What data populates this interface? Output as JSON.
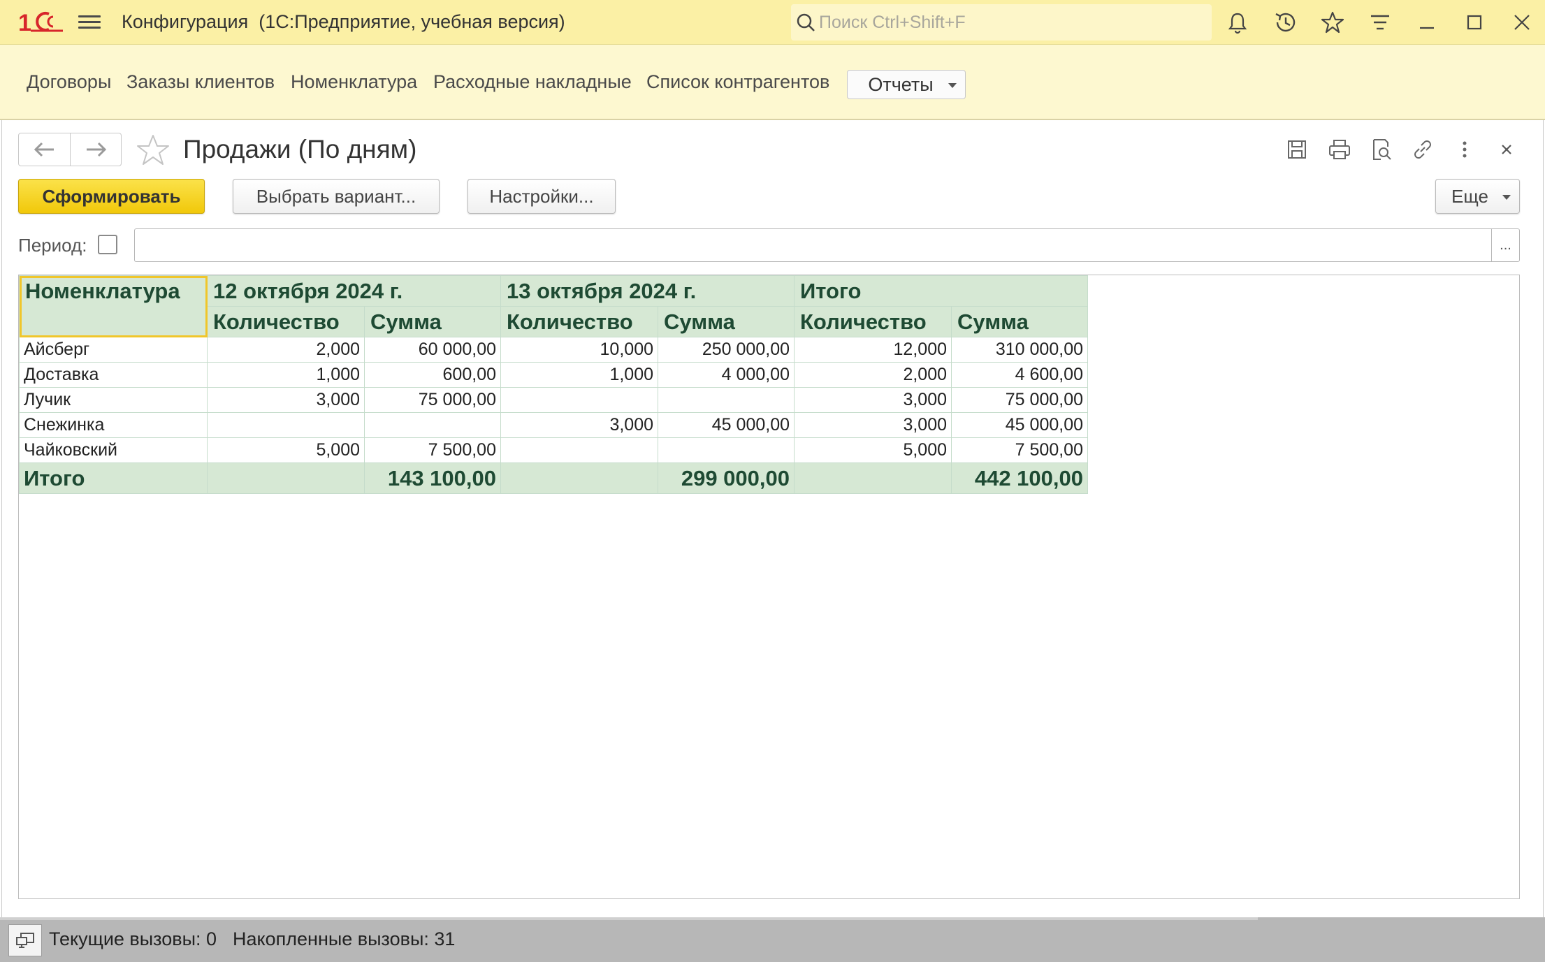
{
  "window": {
    "title": "Конфигурация  (1С:Предприятие, учебная версия)",
    "search_placeholder": "Поиск Ctrl+Shift+F"
  },
  "sections": {
    "items": [
      "Договоры",
      "Заказы клиентов",
      "Номенклатура",
      "Расходные накладные",
      "Список контрагентов"
    ],
    "reports_label": "Отчеты"
  },
  "form": {
    "title": "Продажи (По дням)",
    "generate_label": "Сформировать",
    "choose_variant_label": "Выбрать вариант...",
    "settings_label": "Настройки...",
    "more_label": "Еще",
    "period_label": "Период:",
    "period_value": "",
    "period_button": "..."
  },
  "report": {
    "corner_header": "Номенклатура",
    "groups": [
      "12 октября 2024 г.",
      "13 октября 2024 г.",
      "Итого"
    ],
    "subheaders": [
      "Количество",
      "Сумма",
      "Количество",
      "Сумма",
      "Количество",
      "Сумма"
    ],
    "rows": [
      [
        "Айсберг",
        "2,000",
        "60 000,00",
        "10,000",
        "250 000,00",
        "12,000",
        "310 000,00"
      ],
      [
        "Доставка",
        "1,000",
        "600,00",
        "1,000",
        "4 000,00",
        "2,000",
        "4 600,00"
      ],
      [
        "Лучик",
        "3,000",
        "75 000,00",
        "",
        "",
        "3,000",
        "75 000,00"
      ],
      [
        "Снежинка",
        "",
        "",
        "3,000",
        "45 000,00",
        "3,000",
        "45 000,00"
      ],
      [
        "Чайковский",
        "5,000",
        "7 500,00",
        "",
        "",
        "5,000",
        "7 500,00"
      ]
    ],
    "total": [
      "Итого",
      "",
      "143 100,00",
      "",
      "299 000,00",
      "",
      "442 100,00"
    ]
  },
  "status": {
    "current_calls": "Текущие вызовы: 0",
    "accumulated_calls": "Накопленные вызовы: 31"
  },
  "colors": {
    "titlebar": "#fbf0a5",
    "sections_panel": "#fdf8d0",
    "primary_button": "#f1c80a",
    "report_header": "#d6e8d4",
    "report_header_text": "#1e4a33",
    "logo": "#d7262b"
  },
  "icons": {
    "titlebar": [
      "bell-icon",
      "history-icon",
      "star-icon",
      "functions-menu-icon",
      "minimize-icon",
      "maximize-icon",
      "close-icon"
    ],
    "form": [
      "save-icon",
      "print-icon",
      "preview-icon",
      "link-icon",
      "more-vertical-icon",
      "close-icon"
    ]
  }
}
